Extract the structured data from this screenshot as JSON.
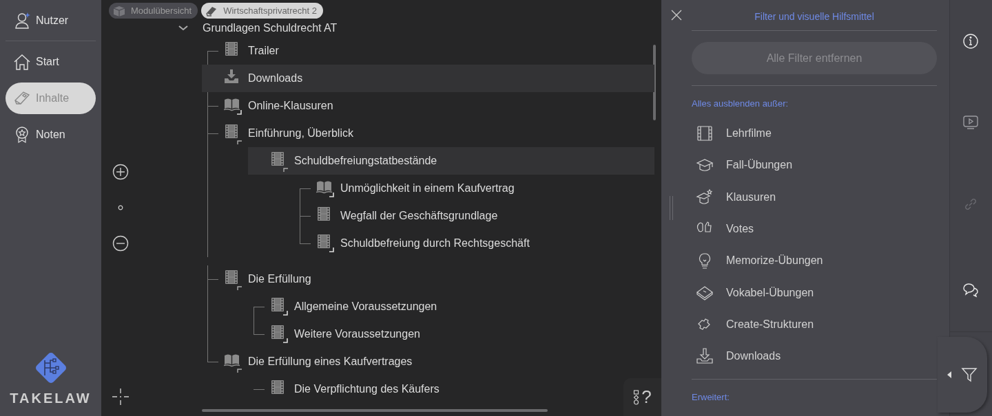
{
  "sidebar": {
    "items": [
      {
        "label": "Nutzer",
        "selected": false
      },
      {
        "label": "Start",
        "selected": false
      },
      {
        "label": "Inhalte",
        "selected": true
      },
      {
        "label": "Noten",
        "selected": false
      }
    ],
    "logo": "TAKELAW"
  },
  "breadcrumb": [
    {
      "label": "Modulübersicht",
      "selected": false
    },
    {
      "label": "Wirtschaftsprivatrecht 2",
      "selected": true
    }
  ],
  "tree": {
    "label": "Grundlagen Schuldrecht AT",
    "children": [
      {
        "label": "Trailer",
        "kind": "video",
        "highlighted": false,
        "linked": false
      },
      {
        "label": "Downloads",
        "kind": "download",
        "highlighted": true,
        "linked": false
      },
      {
        "label": "Online-Klausuren",
        "kind": "exam",
        "highlighted": false,
        "linked": true
      },
      {
        "label": "Einführung, Überblick",
        "kind": "video",
        "highlighted": false,
        "linked": false,
        "children": [
          {
            "label": "Schuldbefreiungstatbestände",
            "kind": "video",
            "highlighted": true,
            "linked": false,
            "children": [
              {
                "label": "Unmöglichkeit in einem Kaufvertrag",
                "kind": "exam",
                "highlighted": false,
                "linked": true
              },
              {
                "label": "Wegfall der Geschäftsgrundlage",
                "kind": "video",
                "highlighted": false,
                "linked": false
              },
              {
                "label": "Schuldbefreiung durch Rechtsgeschäft",
                "kind": "video",
                "highlighted": false,
                "linked": true
              }
            ]
          }
        ]
      },
      {
        "label": "Die Erfüllung",
        "kind": "video",
        "highlighted": false,
        "linked": false,
        "children": [
          {
            "label": "Allgemeine Voraussetzungen",
            "kind": "video",
            "highlighted": false,
            "linked": true
          },
          {
            "label": "Weitere Voraussetzungen",
            "kind": "video",
            "highlighted": false,
            "linked": true
          }
        ]
      },
      {
        "label": "Die Erfüllung eines Kaufvertrages",
        "kind": "exam",
        "highlighted": false,
        "linked": false,
        "children": [
          {
            "label": "Die Verpflichtung des Käufers",
            "kind": "video",
            "highlighted": false,
            "linked": false
          }
        ]
      }
    ]
  },
  "help": "?",
  "filter_panel": {
    "title": "Filter und visuelle Hilfsmittel",
    "clear_button": {
      "label": "Alle Filter entfernen",
      "disabled": true
    },
    "section": "Alles ausblenden außer:",
    "options": [
      "Lehrfilme",
      "Fall-Übungen",
      "Klausuren",
      "Votes",
      "Memorize-Übungen",
      "Vokabel-Übungen",
      "Create-Strukturen",
      "Downloads"
    ],
    "advanced": "Erweitert:"
  },
  "toolbar": [
    {
      "disabled": false
    },
    {
      "disabled": false
    },
    {
      "disabled": true
    },
    {
      "disabled": false
    }
  ]
}
